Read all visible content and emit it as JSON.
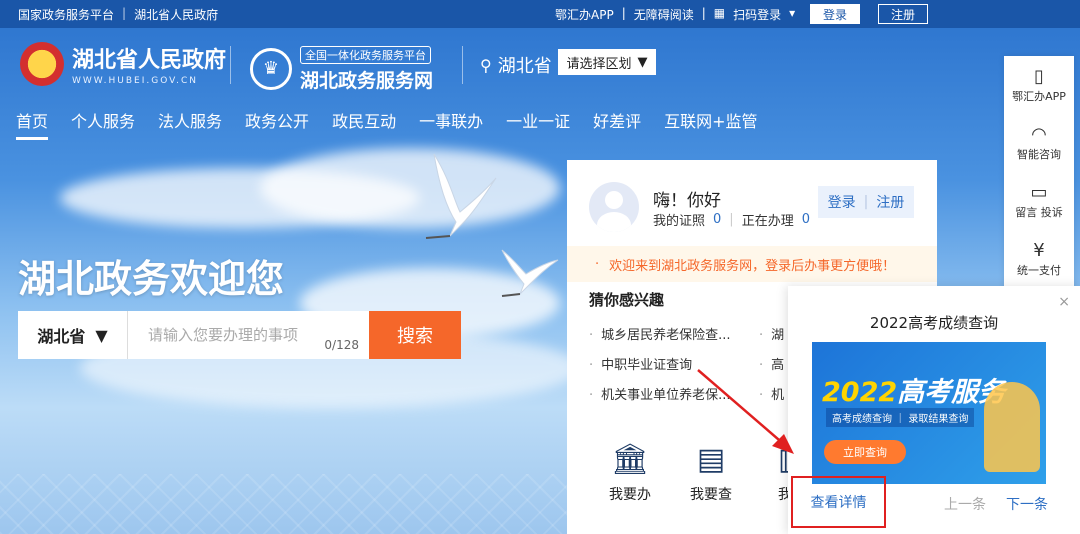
{
  "topbar": {
    "links": [
      "国家政务服务平台",
      "湖北省人民政府"
    ],
    "right_links": [
      "鄂汇办APP",
      "无障碍阅读",
      "扫码登录"
    ],
    "login": "登录",
    "register": "注册"
  },
  "header": {
    "logo1_title": "湖北省人民政府",
    "logo1_sub": "WWW.HUBEI.GOV.CN",
    "logo2_badge": "全国一体化政务服务平台",
    "logo2_title": "湖北政务服务网",
    "region": "湖北省",
    "region_select": "请选择区划"
  },
  "nav": [
    "首页",
    "个人服务",
    "法人服务",
    "政务公开",
    "政民互动",
    "一事联办",
    "一业一证",
    "好差评",
    "互联网+监管"
  ],
  "hero": {
    "welcome": "湖北政务欢迎您",
    "province": "湖北省",
    "search_placeholder": "请输入您要办理的事项",
    "count": "0/128",
    "search_button": "搜索"
  },
  "card": {
    "greeting": "嗨！你好",
    "cert_label": "我的证照",
    "cert_count": "0",
    "handling_label": "正在办理",
    "handling_count": "0",
    "login": "登录",
    "register": "注册",
    "notice": "欢迎来到湖北政务服务网，登录后办事更方便哦！",
    "interest_title": "猜你感兴趣",
    "interests": [
      [
        "城乡居民养老保险查...",
        "湖"
      ],
      [
        "中职毕业证查询",
        "高"
      ],
      [
        "机关事业单位养老保...",
        "机"
      ]
    ],
    "services": [
      {
        "label": "我要办",
        "icon": "bank-icon"
      },
      {
        "label": "我要查",
        "icon": "document-icon"
      },
      {
        "label": "我要",
        "icon": "search-doc-icon"
      }
    ]
  },
  "sidebar": [
    {
      "label": "鄂汇办APP",
      "icon": "phone-icon"
    },
    {
      "label": "智能咨询",
      "icon": "headset-icon"
    },
    {
      "label": "留言 投诉",
      "icon": "message-icon"
    },
    {
      "label": "统一支付",
      "icon": "yuan-icon"
    }
  ],
  "popup": {
    "title": "2022高考成绩查询",
    "banner_year": "2022",
    "banner_title": "高考服务",
    "banner_tags": "高考成绩查询 ｜ 录取结果查询",
    "banner_cta": "立即查询",
    "detail": "查看详情",
    "prev": "上一条",
    "next": "下一条",
    "close": "×"
  },
  "colors": {
    "primary": "#2e6fc4",
    "topbar": "#1a56a8",
    "accent": "#f5672a",
    "annotation": "#e02020"
  }
}
